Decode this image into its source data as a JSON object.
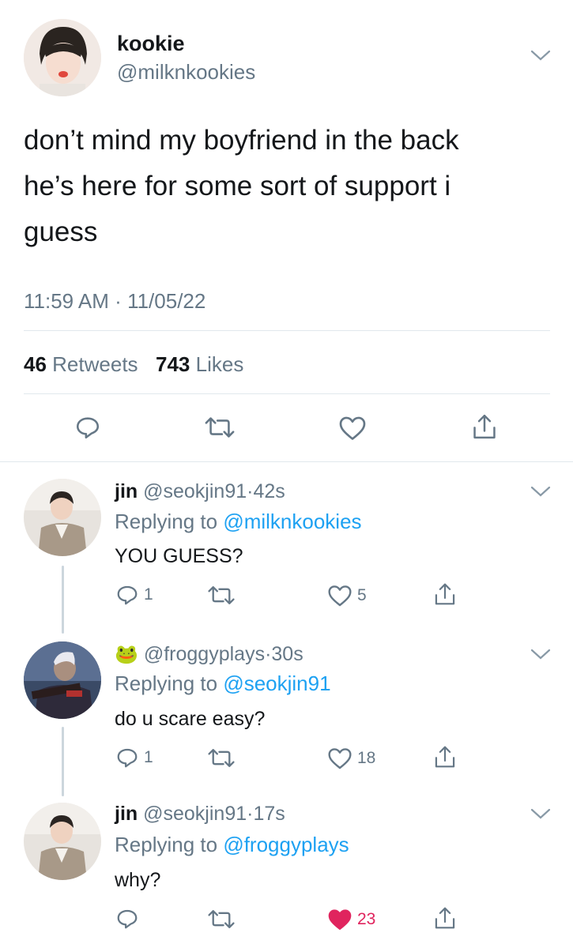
{
  "tweet": {
    "display_name": "kookie",
    "handle": "@milknkookies",
    "text_line1": "don’t mind my boyfriend in the back",
    "text_line2": "he’s here for some sort of support i",
    "text_line3": "guess",
    "time": "11:59 AM",
    "date": "11/05/22",
    "retweets_count": "46",
    "retweets_label": "Retweets",
    "likes_count": "743",
    "likes_label": "Likes"
  },
  "replies": [
    {
      "name": "jin",
      "handle": "@seokjin91",
      "time": "42s",
      "replying_prefix": "Replying to",
      "replying_to": "@milknkookies",
      "text": "YOU GUESS?",
      "reply_count": "1",
      "like_count": "5"
    },
    {
      "name_emoji": "🐸",
      "handle": "@froggyplays",
      "time": "30s",
      "replying_prefix": "Replying to",
      "replying_to": "@seokjin91",
      "text": "do u scare easy?",
      "reply_count": "1",
      "like_count": "18"
    },
    {
      "name": "jin",
      "handle": "@seokjin91",
      "time": "17s",
      "replying_prefix": "Replying to",
      "replying_to": "@froggyplays",
      "text": "why?",
      "like_count": "23"
    }
  ],
  "colors": {
    "accent": "#1da1f2",
    "muted": "#657786",
    "liked": "#e0245e",
    "divider": "#e1e8ed"
  },
  "icons": [
    "chevron-down-icon",
    "reply-icon",
    "retweet-icon",
    "heart-icon",
    "share-icon"
  ]
}
